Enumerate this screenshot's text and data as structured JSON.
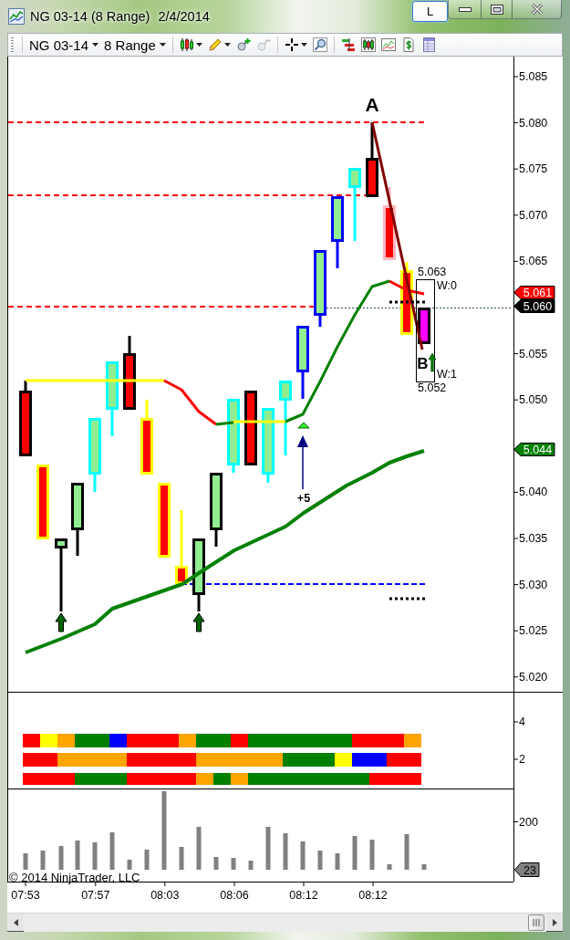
{
  "window": {
    "title": "NG 03-14 (8 Range)",
    "date": "2/4/2014",
    "layout_button": "L"
  },
  "toolbar": {
    "instrument": "NG 03-14",
    "period": "8 Range",
    "tools": [
      {
        "kind": "candles",
        "disabled": false
      },
      {
        "kind": "pencil",
        "disabled": false
      },
      {
        "kind": "zoom-in",
        "disabled": false
      },
      {
        "kind": "zoom-out",
        "disabled": true
      },
      {
        "kind": "crosshair",
        "disabled": false
      },
      {
        "kind": "magnifier",
        "disabled": false
      },
      {
        "kind": "strategy",
        "disabled": false
      },
      {
        "kind": "bars",
        "disabled": false
      },
      {
        "kind": "chart",
        "disabled": false
      },
      {
        "kind": "dollar",
        "disabled": false
      },
      {
        "kind": "table",
        "disabled": false
      }
    ]
  },
  "price_pane": {
    "axis_labels": [
      "5.085",
      "5.080",
      "5.075",
      "5.070",
      "5.065",
      "5.055",
      "5.050",
      "5.040",
      "5.035",
      "5.030",
      "5.025",
      "5.020"
    ],
    "price_markers": [
      {
        "text": "5.061",
        "color": "#ff0000"
      },
      {
        "text": "5.060",
        "color": "#000000"
      },
      {
        "text": "5.044",
        "color": "#008000"
      }
    ],
    "labels": [
      "A",
      "B",
      "+5",
      "5.063",
      "W:0",
      "W:1",
      "5.052"
    ]
  },
  "indicator_pane": {
    "axis_labels": [
      "4",
      "2"
    ]
  },
  "volume_pane": {
    "axis_labels": [
      "200"
    ],
    "marker": "23",
    "copyright": "© 2014 NinjaTrader, LLC"
  },
  "time_axis": [
    "07:53",
    "07:57",
    "08:03",
    "08:06",
    "08:12",
    "08:12"
  ]
}
